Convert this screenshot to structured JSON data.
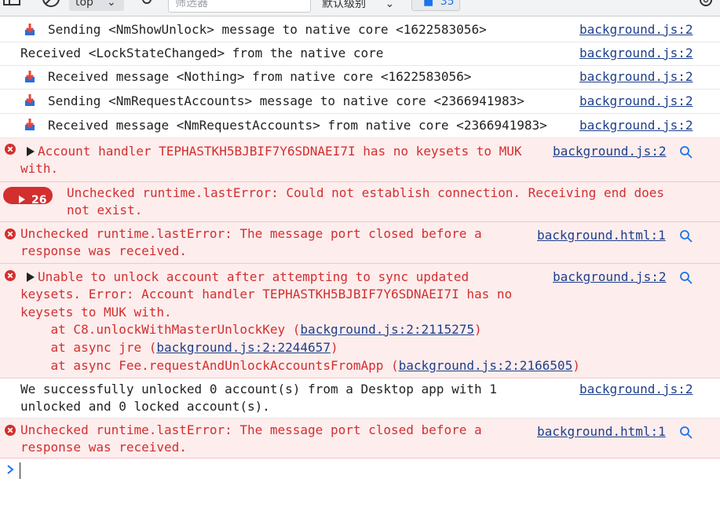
{
  "toolbar": {
    "context_select": "top",
    "filter_placeholder": "筛选器",
    "levels_label": "默认级别",
    "issues_count": "35"
  },
  "console": {
    "rows": [
      {
        "text": "Sending <NmShowUnlock> message to native core <1622583056>",
        "source": "background.js:2"
      },
      {
        "text": "Received <LockStateChanged> from the native core",
        "source": "background.js:2"
      },
      {
        "text": "Received message <Nothing> from native core <1622583056>",
        "source": "background.js:2"
      },
      {
        "text": "Sending <NmRequestAccounts> message to native core <2366941983>",
        "source": "background.js:2"
      },
      {
        "text": "Received message <NmRequestAccounts> from native core <2366941983>",
        "source": "background.js:2"
      }
    ],
    "err1": {
      "line1": "Account handler TEPHASTKH5BJBIF7Y6SDNAEI7I has no keysets to MUK",
      "line2": "with.",
      "source": "background.js:2"
    },
    "err2": {
      "count": "26",
      "line1": "Unchecked runtime.lastError: Could not establish connection. Receiving end does",
      "line2": "not exist."
    },
    "err3": {
      "line1": "Unchecked runtime.lastError: The message port closed before a",
      "line2": "response was received.",
      "source": "background.html:1"
    },
    "err4": {
      "line1": "Unable to unlock account after attempting to sync updated",
      "line2": "keysets. Error: Account handler TEPHASTKH5BJBIF7Y6SDNAEI7I has no",
      "line3": "keysets to MUK with.",
      "stack": [
        {
          "prefix": "    at C8.unlockWithMasterUnlockKey (",
          "link": "background.js:2:2115275",
          "suffix": ")"
        },
        {
          "prefix": "    at async jre (",
          "link": "background.js:2:2244657",
          "suffix": ")"
        },
        {
          "prefix": "    at async Fee.requestAndUnlockAccountsFromApp (",
          "link": "background.js:2:2166505",
          "suffix": ")"
        }
      ],
      "source": "background.js:2"
    },
    "info": {
      "line1": "We successfully unlocked 0 account(s) from a Desktop app with 1",
      "line2": "unlocked and 0 locked account(s).",
      "source": "background.js:2"
    },
    "err5": {
      "line1": "Unchecked runtime.lastError: The message port closed before a",
      "line2": "response was received.",
      "source": "background.html:1"
    }
  },
  "colors": {
    "error_text": "#d32f2f",
    "error_bg": "#fdeded",
    "link": "#1e3f8a",
    "prompt": "#1a73e8"
  }
}
